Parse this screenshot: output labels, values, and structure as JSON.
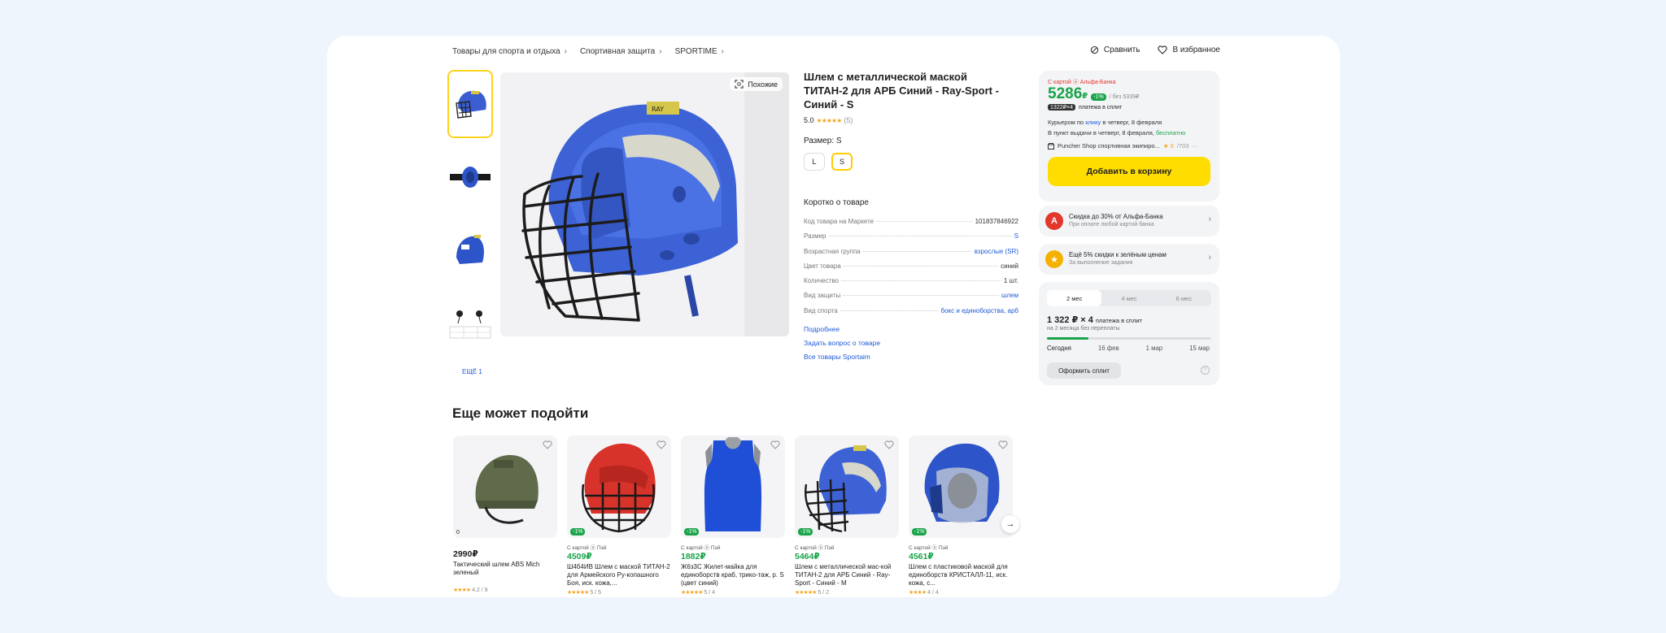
{
  "breadcrumbs": [
    "Товары для спорта и отдыха",
    "Спортивная защита",
    "SPORTIME"
  ],
  "top_actions": {
    "compare": "Сравнить",
    "favorite": "В избранное"
  },
  "gallery": {
    "more_label": "ЕЩЁ 1",
    "similar_label": "Похожие"
  },
  "product": {
    "title": "Шлем с металлической маской ТИТАН-2 для АРБ Синий - Ray-Sport - Синий - S",
    "rating": "5.0",
    "reviews": "(5)",
    "size_label": "Размер: S",
    "sizes": [
      "L",
      "S"
    ],
    "selected_size": "S",
    "about_title": "Коротко о товаре",
    "specs": [
      {
        "key": "Код товара на Маркете",
        "value": "101837846922"
      },
      {
        "key": "Размер",
        "value": "S"
      },
      {
        "key": "Возрастная группа",
        "value": "взрослые (SR)"
      },
      {
        "key": "Цвет товара",
        "value": "синий"
      },
      {
        "key": "Количество",
        "value": "1 шт."
      },
      {
        "key": "Вид защиты",
        "value": "шлем"
      },
      {
        "key": "Вид спорта",
        "value": "бокс и единоборства, арб"
      }
    ],
    "links": [
      "Подробнее",
      "Задать вопрос о товаре",
      "Все товары Sportaim"
    ]
  },
  "buy_box": {
    "card_tag": "С картой ⓐ Альфа-Банка",
    "price": "5286",
    "currency": "₽",
    "discount": "-1%",
    "without_card": "/ без 5339₽",
    "split_pill": "1322₽×4",
    "split_text": "платежа в сплит",
    "delivery_line1_a": "Курьером по ",
    "delivery_line1_link": "клику",
    "delivery_line1_b": " в четверг, 8 февраля",
    "delivery_line2_a": "В пункт выдачи в четверг, 8 февраля, ",
    "delivery_line2_free": "бесплатно",
    "seller": "Puncher Shop спортивная экипиро...",
    "seller_rating": "★ 5",
    "seller_reviews": "/703",
    "add_to_cart": "Добавить в корзину"
  },
  "promos": [
    {
      "icon": "А",
      "title": "Скидка до 30% от Альфа-Банка",
      "subtitle": "При оплате любой картой банка",
      "color": "#e3362d"
    },
    {
      "icon": "★",
      "title": "Ещё 5% скидки к зелёным ценам",
      "subtitle": "За выполнение задания",
      "color": "#f5b100"
    }
  ],
  "split": {
    "tabs": [
      "2 мес",
      "4 мес",
      "6 мес"
    ],
    "active_tab": "2 мес",
    "amount": "1 322 ₽ × 4",
    "amount_suffix": "платежа в сплит",
    "subtitle": "на 2 месяца без переплаты",
    "progress": 0.25,
    "dates": [
      "Сегодня",
      "16 фев",
      "1 мар",
      "15 мар"
    ],
    "button": "Оформить сплит",
    "help": "?"
  },
  "recommendations": {
    "title": "Еще может подойти",
    "items": [
      {
        "badge": "",
        "corner": "0",
        "card_label": "",
        "price": "2990₽",
        "name": "Тактический шлем ABS Mich зеленый",
        "rating": "4.2",
        "reviews": "/ 9",
        "green": false,
        "kind": "tactical"
      },
      {
        "badge": "-1%",
        "corner": "",
        "card_label": "С картой ⓐ Пэй",
        "price": "4509₽",
        "name": "Ш4б4ИВ Шлем с маской ТИТАН-2 для Армейского Ру-копашного Боя, иск. кожа,...",
        "rating": "",
        "reviews": "5 / 5",
        "green": true,
        "kind": "red"
      },
      {
        "badge": "-1%",
        "corner": "",
        "card_label": "С картой ⓐ Пэй",
        "price": "1882₽",
        "name": "Ж6з3С Жилет-майка для единоборств краб, трико-таж, р. S (цвет синий)",
        "rating": "",
        "reviews": "5 / 4",
        "green": true,
        "kind": "vest"
      },
      {
        "badge": "-1%",
        "corner": "",
        "card_label": "С картой ⓐ Пэй",
        "price": "5464₽",
        "name": "Шлем с металлической мас-кой ТИТАН-2 для АРБ Синий - Ray-Sport - Синий - М",
        "rating": "",
        "reviews": "5 / 2",
        "green": true,
        "kind": "blue"
      },
      {
        "badge": "-1%",
        "corner": "",
        "card_label": "С картой ⓐ Пэй",
        "price": "4561₽",
        "name": "Шлем с пластиковой маской для единоборств КРИСТАЛЛ-11, иск. кожа, с...",
        "rating": "",
        "reviews": "4 / 4",
        "green": true,
        "kind": "plastic"
      }
    ]
  }
}
